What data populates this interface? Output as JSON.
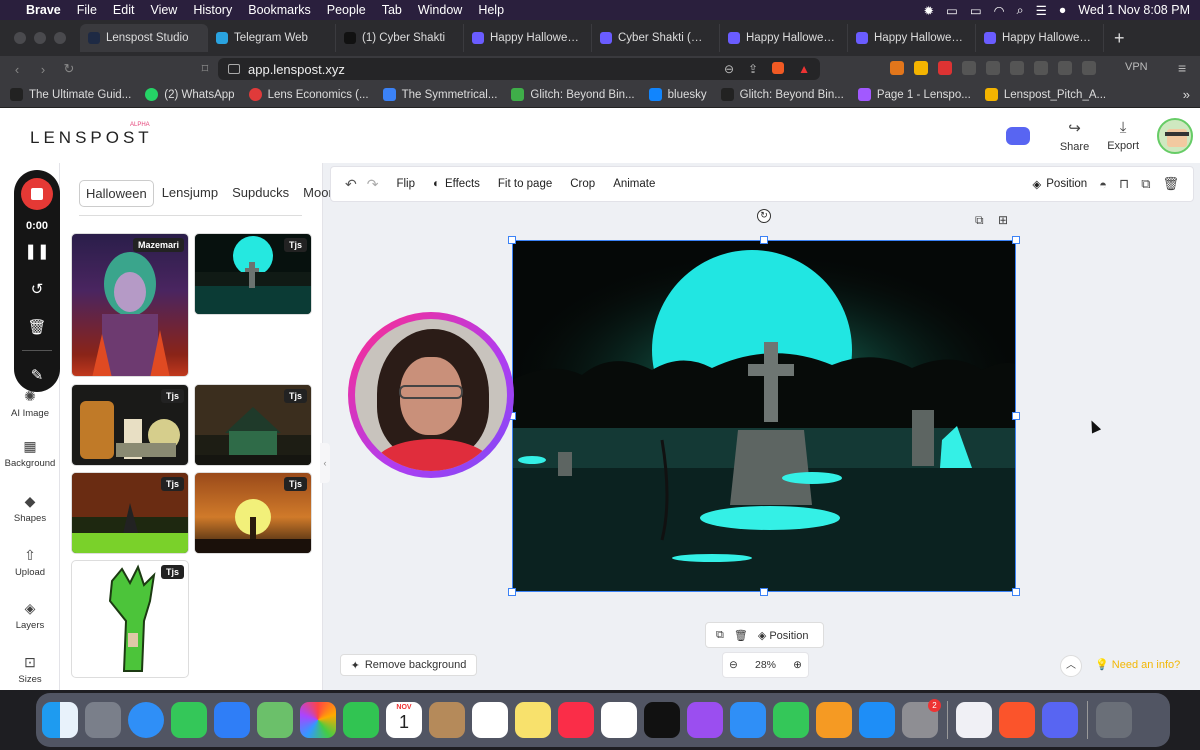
{
  "menubar": {
    "app": "Brave",
    "items": [
      "File",
      "Edit",
      "View",
      "History",
      "Bookmarks",
      "People",
      "Tab",
      "Window",
      "Help"
    ],
    "datetime": "Wed 1 Nov  8:08 PM"
  },
  "tabs": [
    {
      "label": "Lenspost Studio",
      "color": "#1e2a44"
    },
    {
      "label": "Telegram Web",
      "color": "#2aa3e0"
    },
    {
      "label": "(1) Cyber Shakti",
      "color": "#111111"
    },
    {
      "label": "Happy Halloween Ar",
      "color": "#6a5cff"
    },
    {
      "label": "Cyber Shakti (@cybe",
      "color": "#6a5cff"
    },
    {
      "label": "Happy Halloween Ar",
      "color": "#6a5cff"
    },
    {
      "label": "Happy Halloween Ar",
      "color": "#6a5cff"
    },
    {
      "label": "Happy Halloween Ar",
      "color": "#6a5cff"
    }
  ],
  "url": "app.lenspost.xyz",
  "vpn_label": "VPN",
  "bookmarks": [
    {
      "label": "The Ultimate Guid...",
      "color": "#222222"
    },
    {
      "label": "(2) WhatsApp",
      "color": "#25d366"
    },
    {
      "label": "Lens Economics (...",
      "color": "#e03a3a"
    },
    {
      "label": "The Symmetrical...",
      "color": "#3b82f6"
    },
    {
      "label": "Glitch: Beyond Bin...",
      "color": "#3fae49"
    },
    {
      "label": "bluesky",
      "color": "#1185fe"
    },
    {
      "label": "Glitch: Beyond Bin...",
      "color": "#222222"
    },
    {
      "label": "Page 1 - Lenspo...",
      "color": "#a259ff"
    },
    {
      "label": "Lenspost_Pitch_A...",
      "color": "#f4b400"
    }
  ],
  "app": {
    "logo": "LENSPOST",
    "logo_tag": "ALPHA",
    "share_label": "Share",
    "export_label": "Export"
  },
  "rail": {
    "items": [
      {
        "label": "AI Image",
        "icon": "ai-image-icon",
        "glyph": "✺"
      },
      {
        "label": "Background",
        "icon": "background-icon",
        "glyph": "▦"
      },
      {
        "label": "Shapes",
        "icon": "shapes-icon",
        "glyph": "◆"
      },
      {
        "label": "Upload",
        "icon": "upload-icon",
        "glyph": "⇧"
      },
      {
        "label": "Layers",
        "icon": "layers-icon",
        "glyph": "◈"
      },
      {
        "label": "Sizes",
        "icon": "sizes-icon",
        "glyph": "⊡"
      }
    ]
  },
  "recorder": {
    "time": "0:00"
  },
  "panel": {
    "tabs": [
      "Halloween",
      "Lensjump",
      "Supducks",
      "Moon"
    ],
    "thumbs": [
      {
        "badge": "Mazemari"
      },
      {
        "badge": "Tjs"
      },
      {
        "badge": "Tjs"
      },
      {
        "badge": "Tjs"
      },
      {
        "badge": "Tjs"
      },
      {
        "badge": "Tjs"
      },
      {
        "badge": "Tjs"
      }
    ]
  },
  "toolbar": {
    "flip": "Flip",
    "effects": "Effects",
    "fit": "Fit to page",
    "crop": "Crop",
    "animate": "Animate",
    "position": "Position"
  },
  "canvas": {
    "float_position": "Position",
    "remove_bg": "Remove background",
    "zoom": "28%",
    "need_info": "Need an info?"
  },
  "dock": {
    "calendar_month": "NOV",
    "calendar_day": "1",
    "settings_badge": "2"
  }
}
